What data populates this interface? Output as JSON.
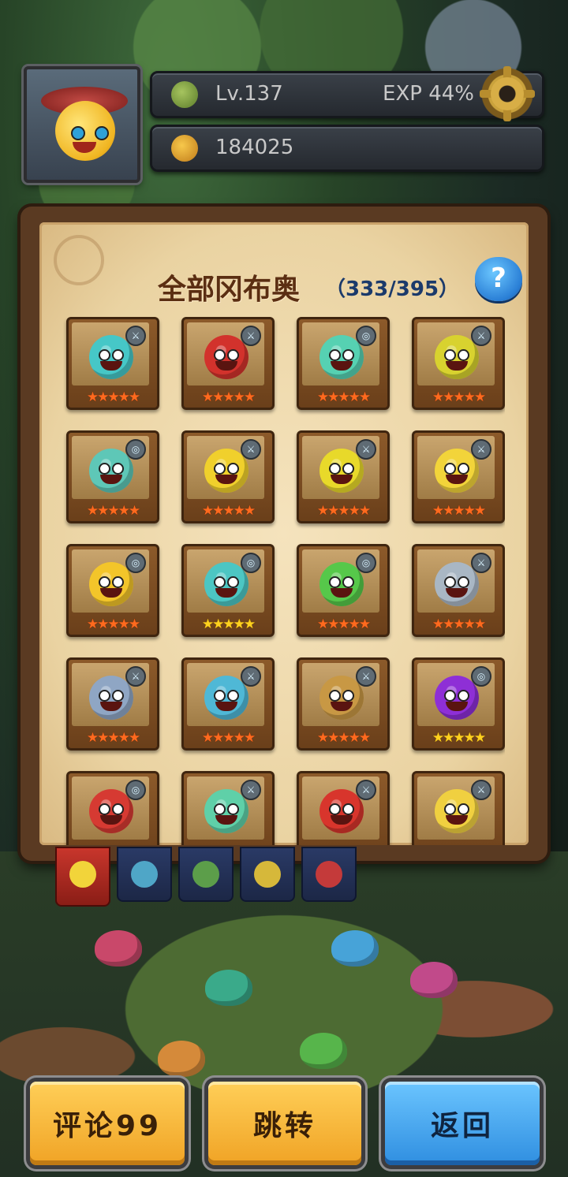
{
  "hud": {
    "level": "Lv.137",
    "exp": "EXP 44%",
    "gold": "184025"
  },
  "panel": {
    "title": "全部冈布奥",
    "count": "（333/395）",
    "help": "?"
  },
  "cards": [
    {
      "color": "#46c7c7",
      "stars": "★★★★★",
      "star_color": "orange",
      "badge": "⚔"
    },
    {
      "color": "#d2322c",
      "stars": "★★★★★",
      "star_color": "orange",
      "badge": "⚔"
    },
    {
      "color": "#56d1b2",
      "stars": "★★★★★",
      "star_color": "orange",
      "badge": "◎"
    },
    {
      "color": "#d8d22f",
      "stars": "★★★★★",
      "star_color": "orange",
      "badge": "⚔"
    },
    {
      "color": "#5ec7b7",
      "stars": "★★★★★",
      "star_color": "orange",
      "badge": "◎"
    },
    {
      "color": "#f0d02c",
      "stars": "★★★★★",
      "star_color": "orange",
      "badge": "⚔"
    },
    {
      "color": "#e8d92a",
      "stars": "★★★★★",
      "star_color": "orange",
      "badge": "⚔"
    },
    {
      "color": "#f2d43a",
      "stars": "★★★★★",
      "star_color": "orange",
      "badge": "⚔"
    },
    {
      "color": "#f3c52a",
      "stars": "★★★★★",
      "star_color": "orange",
      "badge": "◎"
    },
    {
      "color": "#4cc6c3",
      "stars": "★★★★★",
      "star_color": "gold",
      "badge": "◎"
    },
    {
      "color": "#56c84a",
      "stars": "★★★★★",
      "star_color": "orange",
      "badge": "◎"
    },
    {
      "color": "#a9b7c4",
      "stars": "★★★★★",
      "star_color": "orange",
      "badge": "⚔"
    },
    {
      "color": "#8fa6c4",
      "stars": "★★★★★",
      "star_color": "orange",
      "badge": "⚔"
    },
    {
      "color": "#4fb8d6",
      "stars": "★★★★★",
      "star_color": "orange",
      "badge": "⚔"
    },
    {
      "color": "#c89844",
      "stars": "★★★★★",
      "star_color": "orange",
      "badge": "⚔"
    },
    {
      "color": "#8e2fd6",
      "stars": "★★★★★",
      "star_color": "gold",
      "badge": "◎"
    },
    {
      "color": "#d63a32",
      "stars": "★★★★★",
      "star_color": "orange",
      "badge": "◎"
    },
    {
      "color": "#5fd0a8",
      "stars": "★★★★★",
      "star_color": "orange",
      "badge": "⚔"
    },
    {
      "color": "#d8352c",
      "stars": "★★★★★",
      "star_color": "orange",
      "badge": "⚔"
    },
    {
      "color": "#f0d040",
      "stars": "★★★★★",
      "star_color": "orange",
      "badge": "⚔"
    }
  ],
  "tabs": [
    {
      "icon_color": "#f2d43a",
      "active": true
    },
    {
      "icon_color": "#4fa6c7",
      "active": false
    },
    {
      "icon_color": "#5c9e4a",
      "active": false
    },
    {
      "icon_color": "#d6b83a",
      "active": false
    },
    {
      "icon_color": "#c43a3a",
      "active": false
    }
  ],
  "buttons": {
    "comment": "评论99",
    "jump": "跳转",
    "back": "返回"
  },
  "icons": {
    "level": "clover-icon",
    "gold": "gold-fruit-icon",
    "settings": "gear-icon"
  }
}
